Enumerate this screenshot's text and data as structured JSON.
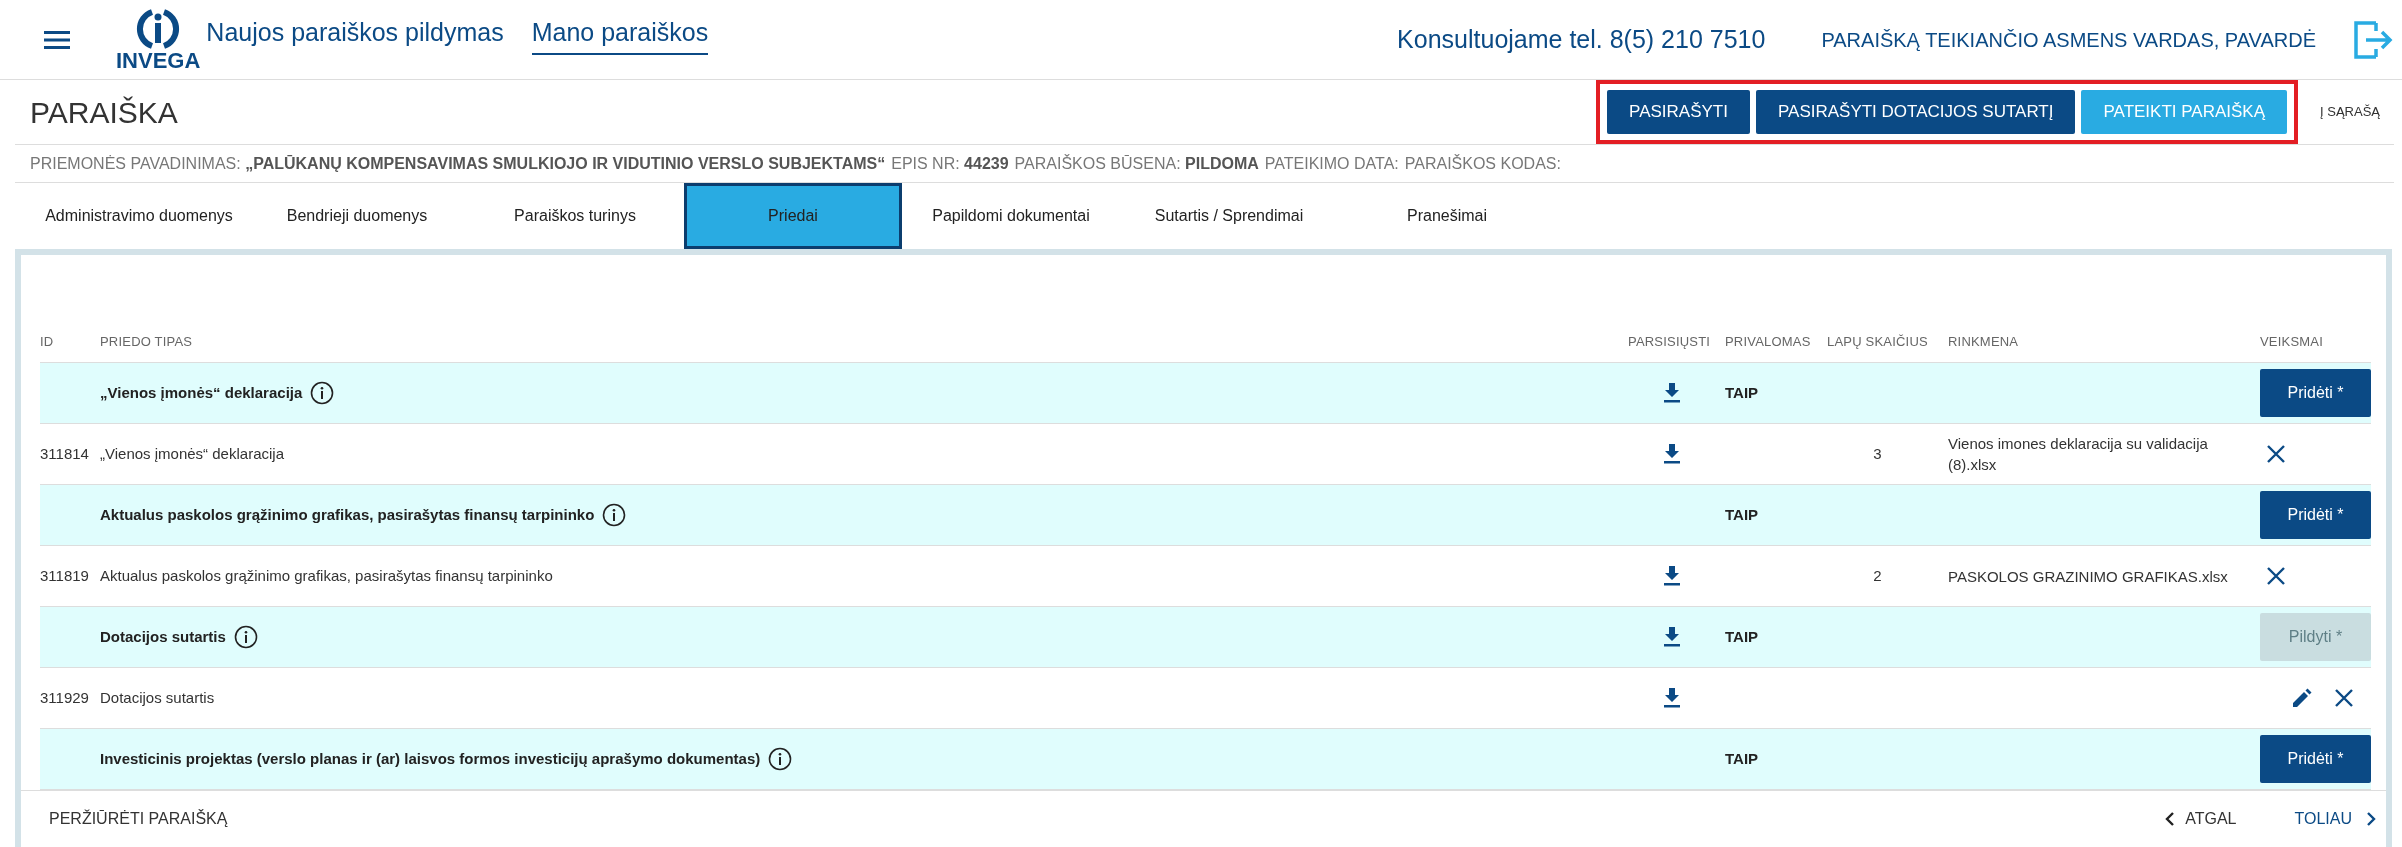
{
  "header": {
    "logo_text": "INVEGA",
    "nav": [
      {
        "label": "Naujos paraiškos pildymas",
        "selected": false
      },
      {
        "label": "Mano paraiškos",
        "selected": true
      }
    ],
    "phone": "Konsultuojame tel. 8(5) 210 7510",
    "user": "PARAIŠKĄ TEIKIANČIO ASMENS VARDAS, PAVARDĖ"
  },
  "title": "PARAIŠKA",
  "actions": [
    {
      "label": "PASIRAŠYTI",
      "kind": "dark"
    },
    {
      "label": "PASIRAŠYTI DOTACIJOS SUTARTĮ",
      "kind": "dark"
    },
    {
      "label": "PATEIKTI PARAIŠKĄ",
      "kind": "light"
    }
  ],
  "back_link": "Į SĄRAŠĄ",
  "info": [
    {
      "label": "PRIEMONĖS PAVADINIMAS:",
      "value": "„PALŪKANŲ KOMPENSAVIMAS SMULKIOJO IR VIDUTINIO VERSLO SUBJEKTAMS“"
    },
    {
      "label": "EPIS NR:",
      "value": "44239"
    },
    {
      "label": "PARAIŠKOS BŪSENA:",
      "value": "PILDOMA"
    },
    {
      "label": "PATEIKIMO DATA:"
    },
    {
      "label": "PARAIŠKOS KODAS:"
    }
  ],
  "tabs": [
    {
      "label": "Administravimo duomenys",
      "selected": false
    },
    {
      "label": "Bendrieji duomenys",
      "selected": false
    },
    {
      "label": "Paraiškos turinys",
      "selected": false
    },
    {
      "label": "Priedai",
      "selected": true
    },
    {
      "label": "Papildomi dokumentai",
      "selected": false
    },
    {
      "label": "Sutartis / Sprendimai",
      "selected": false
    },
    {
      "label": "Pranešimai",
      "selected": false
    }
  ],
  "table": {
    "columns": [
      "ID",
      "PRIEDO TIPAS",
      "PARSISIŲSTI",
      "PRIVALOMAS",
      "LAPŲ SKAIČIUS",
      "RINKMENA",
      "VEIKSMAI"
    ],
    "rows": [
      {
        "kind": "group",
        "title": "„Vienos įmonės“ deklaracija",
        "download": true,
        "required": "TAIP",
        "button": {
          "label": "Pridėti *",
          "disabled": false
        }
      },
      {
        "kind": "item",
        "id": "311814",
        "title": "„Vienos įmonės“ deklaracija",
        "download": true,
        "pages": "3",
        "file": "Vienos imones deklaracija su validacija (8).xlsx",
        "edit": false,
        "delete": true
      },
      {
        "kind": "group",
        "title": "Aktualus paskolos grąžinimo grafikas, pasirašytas finansų tarpininko",
        "download": false,
        "required": "TAIP",
        "button": {
          "label": "Pridėti *",
          "disabled": false
        }
      },
      {
        "kind": "item",
        "id": "311819",
        "title": "Aktualus paskolos grąžinimo grafikas, pasirašytas finansų tarpininko",
        "download": true,
        "pages": "2",
        "file": "PASKOLOS GRAZINIMO GRAFIKAS.xlsx",
        "edit": false,
        "delete": true
      },
      {
        "kind": "group",
        "title": "Dotacijos sutartis",
        "download": true,
        "required": "TAIP",
        "button": {
          "label": "Pildyti *",
          "disabled": true
        }
      },
      {
        "kind": "item",
        "id": "311929",
        "title": "Dotacijos sutartis",
        "download": true,
        "edit": true,
        "delete": true
      },
      {
        "kind": "group",
        "title": "Investicinis projektas (verslo planas ir (ar) laisvos formos investicijų aprašymo dokumentas)",
        "download": false,
        "required": "TAIP",
        "button": {
          "label": "Pridėti *",
          "disabled": false
        }
      }
    ]
  },
  "footer": {
    "preview": "PERŽIŪRĖTI PARAIŠKĄ",
    "back": "ATGAL",
    "next": "TOLIAU"
  }
}
